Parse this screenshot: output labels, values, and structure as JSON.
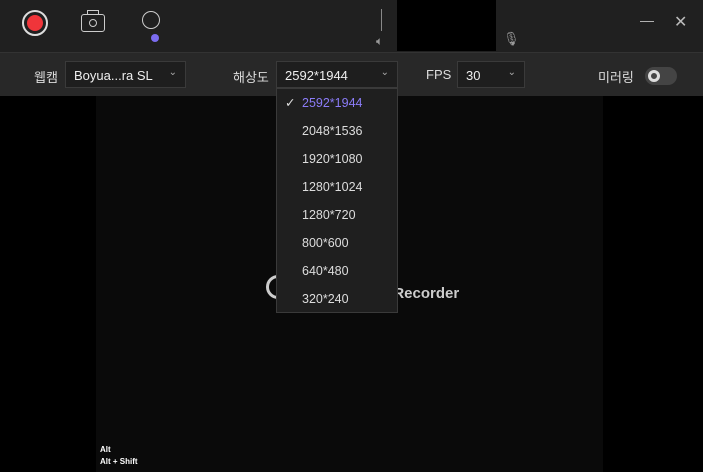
{
  "toolbar": {
    "record": "record-icon",
    "screenshot": "camera-icon",
    "webcam": "webcam-icon"
  },
  "window": {
    "minimize": "minimize-icon",
    "close": "close-icon",
    "close_glyph": "✕",
    "min_glyph": "—"
  },
  "settings": {
    "webcam_label": "웹캠",
    "webcam_value": "Boyua...ra SL",
    "resolution_label": "해상도",
    "resolution_value": "2592*1944",
    "fps_label": "FPS",
    "fps_value": "30",
    "mirror_label": "미러링",
    "mirror_on": false
  },
  "resolution_options": [
    "2592*1944",
    "2048*1536",
    "1920*1080",
    "1280*1024",
    "1280*720",
    "800*600",
    "640*480",
    "320*240"
  ],
  "selected_check": "✓",
  "preview": {
    "watermark_text": "n Recorder",
    "hotkey1": "Alt",
    "hotkey2": "Alt + Shift"
  },
  "colors": {
    "accent": "#8b7cf8",
    "record": "#f0353a"
  }
}
